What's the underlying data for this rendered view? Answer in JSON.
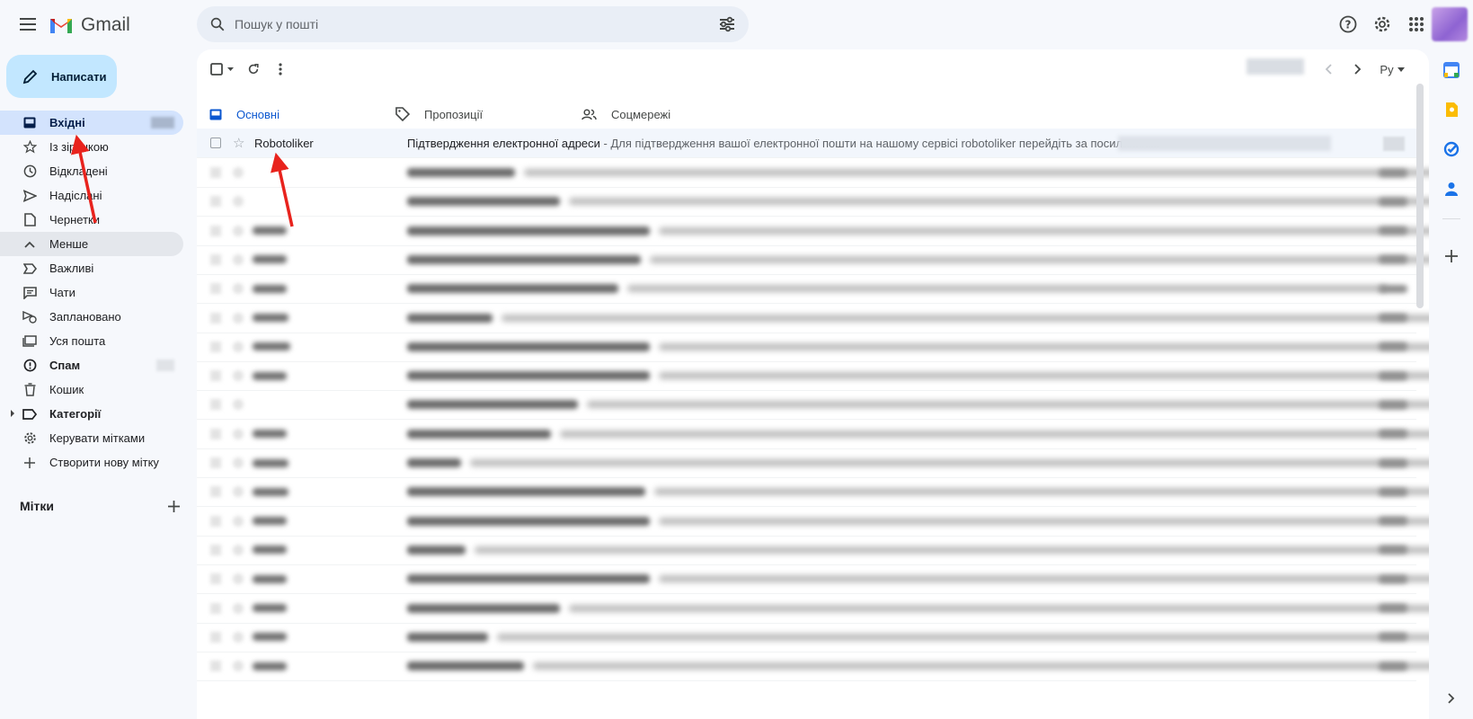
{
  "app": {
    "title": "Gmail"
  },
  "search": {
    "placeholder": "Пошук у пошті"
  },
  "compose": {
    "label": "Написати"
  },
  "sidebar": {
    "items": [
      {
        "label": "Вхідні",
        "icon": "inbox-icon",
        "active": true
      },
      {
        "label": "Із зірочкою",
        "icon": "star-icon"
      },
      {
        "label": "Відкладені",
        "icon": "clock-icon"
      },
      {
        "label": "Надіслані",
        "icon": "send-icon"
      },
      {
        "label": "Чернетки",
        "icon": "draft-icon"
      },
      {
        "label": "Менше",
        "icon": "chevron-up-icon"
      },
      {
        "label": "Важливі",
        "icon": "important-icon"
      },
      {
        "label": "Чати",
        "icon": "chat-icon"
      },
      {
        "label": "Заплановано",
        "icon": "scheduled-send-icon"
      },
      {
        "label": "Уся пошта",
        "icon": "all-mail-icon"
      },
      {
        "label": "Спам",
        "icon": "spam-icon"
      },
      {
        "label": "Кошик",
        "icon": "trash-icon"
      },
      {
        "label": "Категорії",
        "icon": "label-icon"
      },
      {
        "label": "Керувати мітками",
        "icon": "gear-icon"
      },
      {
        "label": "Створити нову мітку",
        "icon": "plus-icon"
      }
    ],
    "labels_header": "Мітки"
  },
  "toolbar": {
    "input_tools_label": "Ру"
  },
  "tabs": [
    {
      "label": "Основні",
      "icon": "inbox-icon",
      "active": true
    },
    {
      "label": "Пропозиції",
      "icon": "tag-icon"
    },
    {
      "label": "Соцмережі",
      "icon": "people-icon"
    }
  ],
  "emails": [
    {
      "sender": "Robotoliker",
      "subject": "Підтвердження електронної адреси",
      "snippet": " - Для підтвердження вашої електронної пошти на нашому сервісі robotoliker перейдіть за посиланням:"
    }
  ],
  "colors": {
    "accent": "#0b57d0",
    "compose_bg": "#c2e7ff",
    "active_nav_bg": "#d3e3fd",
    "annotation_arrow": "#e8231d"
  }
}
